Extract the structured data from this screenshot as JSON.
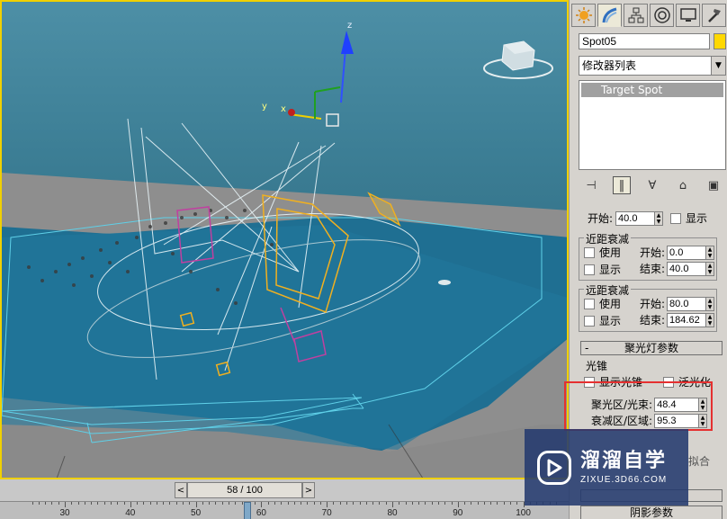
{
  "viewport": {
    "axes": {
      "x": "x",
      "y": "y",
      "z": "z"
    },
    "accent_border": "#f0d000"
  },
  "tabs": [
    {
      "icon": "sun-icon",
      "active": false
    },
    {
      "icon": "modify-icon",
      "active": true
    },
    {
      "icon": "hierarchy-icon",
      "active": false
    },
    {
      "icon": "motion-icon",
      "active": false
    },
    {
      "icon": "display-icon",
      "active": false
    },
    {
      "icon": "utilities-hammer-icon",
      "active": false
    }
  ],
  "object": {
    "name": "Spot05",
    "color": "#ffd800"
  },
  "modifier_list": {
    "label": "修改器列表"
  },
  "stack": {
    "items": [
      "Target Spot"
    ]
  },
  "rollouts": {
    "partial_row": {
      "label": "开始:",
      "value": "40.0",
      "show_label": "显示"
    },
    "near_atten": {
      "title": "近距衰减",
      "use_label": "使用",
      "start_label": "开始:",
      "start_value": "0.0",
      "show_label": "显示",
      "end_label": "结束:",
      "end_value": "40.0"
    },
    "far_atten": {
      "title": "远距衰减",
      "use_label": "使用",
      "start_label": "开始:",
      "start_value": "80.0",
      "show_label": "显示",
      "end_label": "结束:",
      "end_value": "184.62"
    },
    "spotlight_params": {
      "sign": "-",
      "title": "聚光灯参数",
      "cone_group": "光锥",
      "show_cone": "显示光锥",
      "overshoot": "泛光化",
      "hotspot_label": "聚光区/光束:",
      "hotspot_value": "48.4",
      "falloff_label": "衰减区/区域:",
      "falloff_value": "95.3"
    },
    "partial_bottom": {
      "button_fragment": "拟合",
      "next_rollout": "阴影参数"
    }
  },
  "timeline": {
    "slider_text": "58 / 100",
    "prev": "<",
    "next": ">",
    "tick_labels": [
      "30",
      "40",
      "50",
      "60",
      "70",
      "80",
      "90",
      "100"
    ]
  },
  "watermark": {
    "title": "溜溜自学",
    "url": "ZIXUE.3D66.COM"
  }
}
